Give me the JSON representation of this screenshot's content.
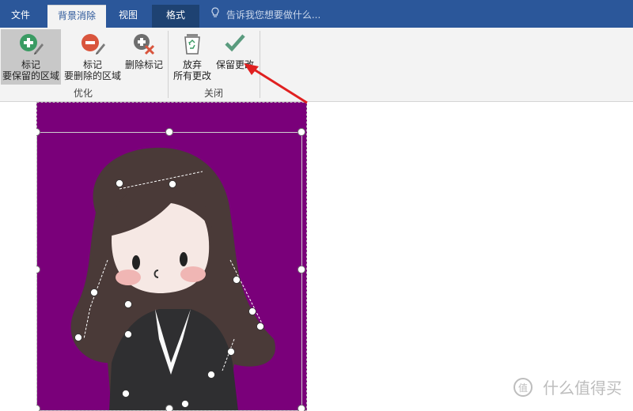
{
  "tabs": {
    "file": "文件",
    "background_removal": "背景消除",
    "view": "视图",
    "format": "格式"
  },
  "tell_me": {
    "icon": "lightbulb-icon",
    "placeholder": "告诉我您想要做什么..."
  },
  "ribbon": {
    "optimize_group": {
      "label": "优化",
      "mark_keep": {
        "line1": "标记",
        "line2": "要保留的区域",
        "icon": "plus-pencil-icon"
      },
      "mark_remove": {
        "line1": "标记",
        "line2": "要删除的区域",
        "icon": "minus-pencil-icon"
      },
      "delete_mark": {
        "line1": "删除标记",
        "icon": "delete-mark-icon"
      }
    },
    "close_group": {
      "label": "关闭",
      "discard": {
        "line1": "放弃",
        "line2": "所有更改",
        "icon": "recycle-bin-icon"
      },
      "keep": {
        "line1": "保留更改",
        "icon": "check-icon"
      }
    }
  },
  "watermark": {
    "text": "什么值得买",
    "icon": "smzdm-icon"
  },
  "colors": {
    "ribbon_blue": "#2b579a",
    "removed_area": "#7a007a",
    "annotation_arrow": "#e02020"
  }
}
